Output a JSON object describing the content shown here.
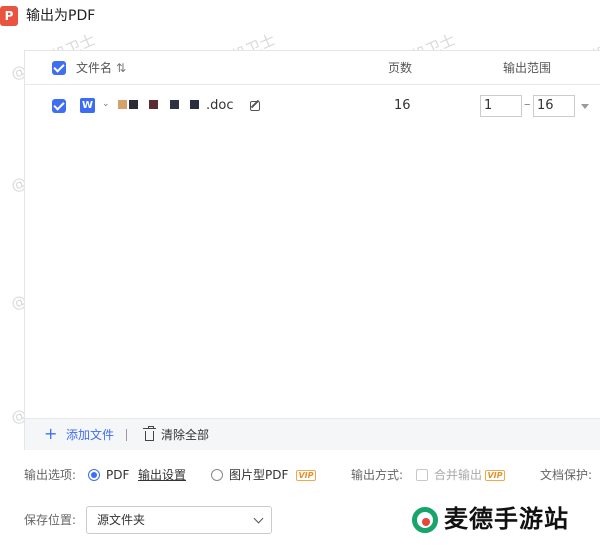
{
  "window": {
    "title": "输出为PDF",
    "app_icon_glyph": "P"
  },
  "table": {
    "headers": {
      "filename": "文件名",
      "pages": "页数",
      "range": "输出范围"
    },
    "sort_glyph": "⇅",
    "rows": [
      {
        "checked": true,
        "name_prefix": "⌄",
        "name_suffix": ".doc",
        "pages": "16",
        "range_from": "1",
        "range_to": "16"
      }
    ],
    "obscured_colors": [
      "#d6a06a",
      "#2b2b36",
      "#5a2a35",
      "#2e3140",
      "#2a2d3b"
    ]
  },
  "panel_bar": {
    "add_glyph": "+",
    "add_label": "添加文件",
    "clear_label": "清除全部"
  },
  "options": {
    "label": "输出选项:",
    "pdf_label": "PDF",
    "pdf_selected": true,
    "settings_link": "输出设置",
    "image_pdf_label": "图片型PDF",
    "vip_badge": "VIP",
    "output_method_label": "输出方式:",
    "merge_label": "合并输出",
    "doc_protect_label": "文档保护:"
  },
  "save": {
    "label": "保存位置:",
    "value": "源文件夹"
  },
  "watermark": {
    "text": "@打印机卫士"
  },
  "brand": {
    "text": "麦德手游站"
  },
  "colors": {
    "accent": "#3f6ef5",
    "app_icon": "#e9543f",
    "word_icon": "#3a6cf4",
    "vip": "#f0a94a",
    "brand_green": "#18a56c",
    "brand_red": "#e8453c"
  }
}
